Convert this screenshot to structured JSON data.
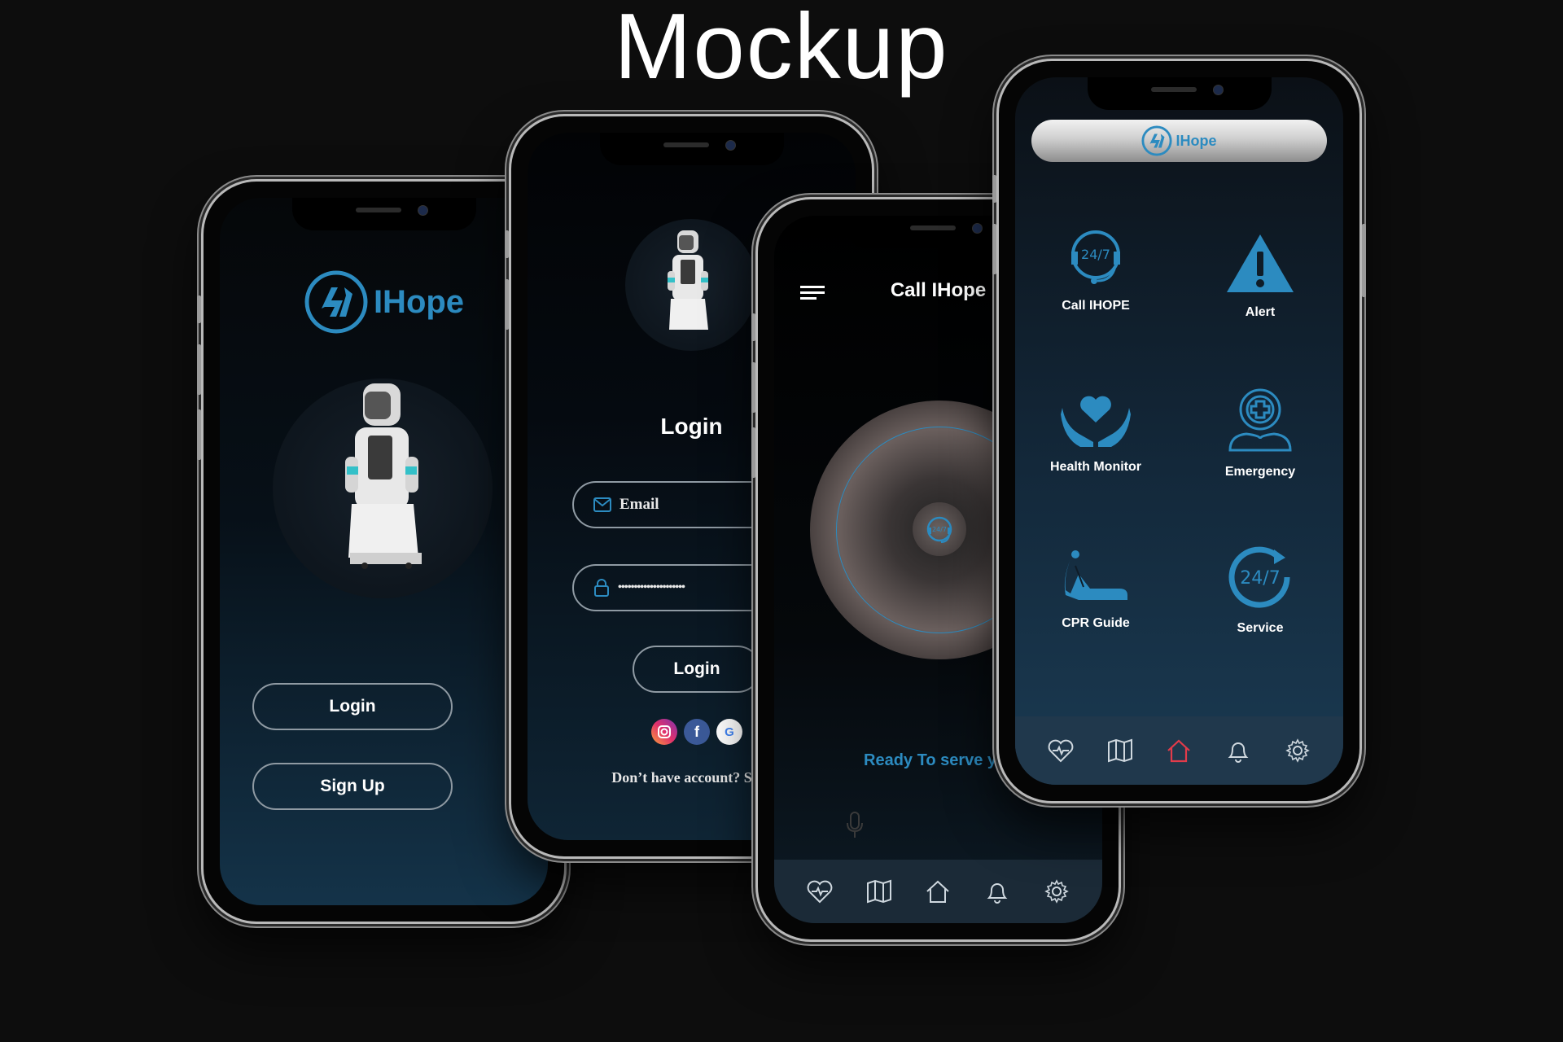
{
  "page": {
    "title": "Mockup"
  },
  "brand": {
    "name": "IHope",
    "accent_color": "#2c8bc0",
    "alert_color": "#e23b4a"
  },
  "welcome_screen": {
    "logo_text": "IHope",
    "login_label": "Login",
    "signup_label": "Sign Up"
  },
  "login_screen": {
    "title": "Login",
    "email_placeholder": "Email",
    "password_value": "•••••••••••••••••••••",
    "login_label": "Login",
    "social": [
      "instagram-icon",
      "facebook-icon",
      "google-icon"
    ],
    "facebook_glyph": "f",
    "google_glyph": "G",
    "footer_text": "Don’t have account? Sign"
  },
  "call_screen": {
    "title": "Call IHope",
    "status_text": "Ready To serve yo",
    "center_icon": "24/7",
    "nav": [
      "heart-pulse-icon",
      "map-icon",
      "home-icon",
      "bell-icon",
      "gear-icon"
    ]
  },
  "home_screen": {
    "header_logo_text": "IHope",
    "tiles": [
      {
        "label": "Call IHOPE",
        "icon": "headset-24-7-icon"
      },
      {
        "label": "Alert",
        "icon": "warning-icon"
      },
      {
        "label": "Health Monitor",
        "icon": "heart-hands-icon"
      },
      {
        "label": "Emergency",
        "icon": "medical-cross-icon"
      },
      {
        "label": "CPR Guide",
        "icon": "cpr-icon"
      },
      {
        "label": "Service",
        "icon": "service-24-7-icon"
      }
    ],
    "badge_24_7": "24/7",
    "nav": [
      "heart-pulse-icon",
      "map-icon",
      "home-icon",
      "bell-icon",
      "gear-icon"
    ],
    "active_nav": "home-icon"
  }
}
